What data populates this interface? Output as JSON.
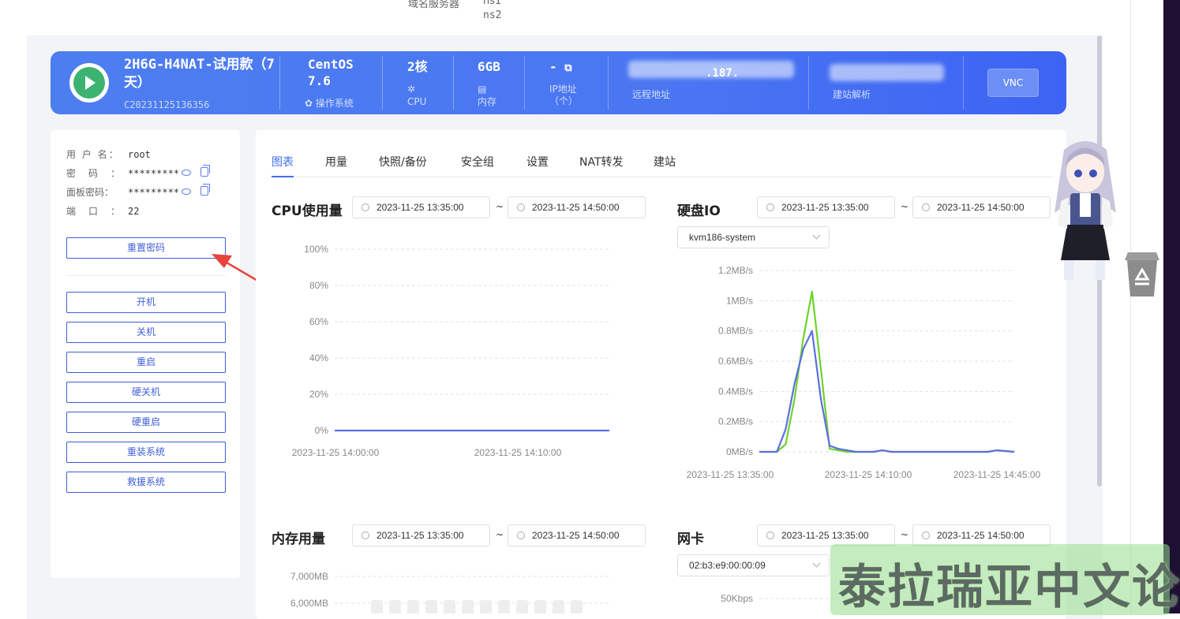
{
  "top_info": {
    "label": "域名服务器",
    "ns1": "ns1",
    "ns2": "ns2"
  },
  "banner": {
    "name": "2H6G-H4NAT-试用款（7天）",
    "code": "C20231125136356",
    "os_value": "CentOS 7.6",
    "os_label": "操作系统",
    "cpu_value": "2核",
    "cpu_label": "CPU",
    "mem_value": "6GB",
    "mem_label": "内存",
    "ip_value": "-",
    "ip_label": "IP地址（个）",
    "remote_value": ".187.",
    "remote_label": "远程地址",
    "dns_label": "建站解析",
    "vnc_label": "VNC"
  },
  "account": {
    "username_label": "用 户 名：",
    "username": "root",
    "password_label": "密　码　：",
    "password": "*********",
    "panel_password_label": "面板密码：",
    "panel_password": "*********",
    "port_label": "端　口　：",
    "port": "22"
  },
  "actions": {
    "reset_password": "重置密码",
    "power_on": "开机",
    "shutdown": "关机",
    "restart": "重启",
    "hard_shutdown": "硬关机",
    "hard_restart": "硬重启",
    "reinstall": "重装系统",
    "rescue": "救援系统"
  },
  "tabs": [
    "图表",
    "用量",
    "快照/备份",
    "安全组",
    "设置",
    "NAT转发",
    "建站"
  ],
  "charts": {
    "cpu": {
      "title": "CPU使用量",
      "start": "2023-11-25 13:35:00",
      "end": "2023-11-25 14:50:00"
    },
    "disk": {
      "title": "硬盘IO",
      "start": "2023-11-25 13:35:00",
      "end": "2023-11-25 14:50:00",
      "device": "kvm186-system"
    },
    "memory": {
      "title": "内存用量",
      "start": "2023-11-25 13:35:00",
      "end": "2023-11-25 14:50:00"
    },
    "nic": {
      "title": "网卡",
      "start": "2023-11-25 13:35:00",
      "end": "2023-11-25 14:50:00",
      "device": "02:b3:e9:00:00:09"
    },
    "separator": "~"
  },
  "chart_data": [
    {
      "type": "line",
      "y_ticks": [
        "100%",
        "80%",
        "60%",
        "40%",
        "20%",
        "0%"
      ],
      "ylim": [
        0,
        100
      ],
      "x_ticks": [
        "2023-11-25 14:00:00",
        "2023-11-25 14:10:00"
      ],
      "series": [
        {
          "values": [
            0,
            0,
            0,
            0,
            0,
            0,
            0,
            0,
            0,
            0
          ],
          "color": "#5b6fe0"
        }
      ]
    },
    {
      "type": "line",
      "y_ticks": [
        "1.2MB/s",
        "1MB/s",
        "0.8MB/s",
        "0.6MB/s",
        "0.4MB/s",
        "0.2MB/s",
        "0MB/s"
      ],
      "ylim": [
        0,
        1.2
      ],
      "x_ticks": [
        "2023-11-25 13:35:00",
        "2023-11-25 14:10:00",
        "2023-11-25 14:45:00"
      ],
      "series": [
        {
          "values": [
            0,
            0,
            0,
            0.05,
            0.35,
            0.75,
            1.06,
            0.55,
            0.02,
            0.01,
            0,
            0,
            0,
            0,
            0.01,
            0,
            0,
            0,
            0,
            0,
            0,
            0,
            0,
            0,
            0,
            0,
            0,
            0.01,
            0.005,
            0
          ],
          "color": "#6dd32a"
        },
        {
          "values": [
            0,
            0,
            0,
            0.15,
            0.45,
            0.68,
            0.8,
            0.35,
            0.04,
            0.02,
            0.01,
            0,
            0,
            0,
            0.01,
            0,
            0,
            0,
            0,
            0,
            0,
            0,
            0,
            0,
            0,
            0,
            0,
            0.01,
            0.005,
            0
          ],
          "color": "#5b6fe0"
        }
      ]
    },
    {
      "type": "bar",
      "y_ticks": [
        "7,000MB",
        "6,000MB"
      ]
    },
    {
      "type": "line",
      "y_ticks": [
        "50Kbps"
      ]
    }
  ],
  "watermark": "泰拉瑞亚中文论坛"
}
